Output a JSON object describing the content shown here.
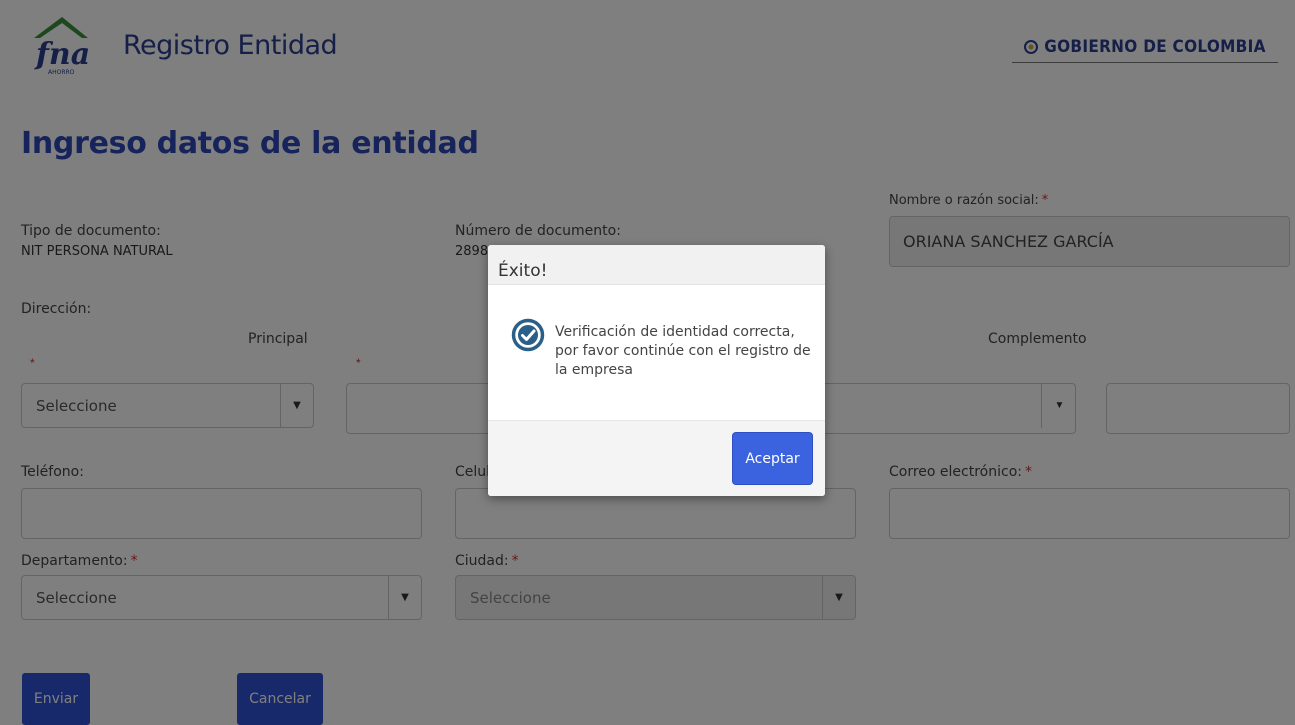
{
  "header": {
    "logo_text": "fna",
    "logo_sub": "AHORRO",
    "app_title": "Registro Entidad",
    "government": "GOBIERNO DE COLOMBIA"
  },
  "page_title": "Ingreso datos de la entidad",
  "form": {
    "doc_type_label": "Tipo de documento:",
    "doc_type_value": "NIT PERSONA NATURAL",
    "doc_number_label": "Número de documento:",
    "doc_number_value": "2898",
    "name_label": "Nombre o razón social:",
    "name_value": "ORIANA SANCHEZ GARCÍA",
    "address_label": "Dirección:",
    "principal_label": "Principal",
    "complemento_label": "Complemento",
    "required_mark": "*",
    "principal_select": "Seleccione",
    "phone_label": "Teléfono:",
    "cell_label": "Celul",
    "email_label": "Correo electrónico:",
    "department_label": "Departamento:",
    "department_select": "Seleccione",
    "city_label": "Ciudad:",
    "city_select": "Seleccione",
    "submit_button": "Enviar",
    "cancel_button": "Cancelar"
  },
  "modal": {
    "title": "Éxito!",
    "message": "Verificación de identidad correcta, por favor continúe con el registro de la empresa",
    "accept_button": "Aceptar"
  },
  "colors": {
    "brand_blue": "#2b3e8f",
    "button_blue": "#2f53d4",
    "required_red": "#d32f2f",
    "success_icon": "#2a5f8a"
  }
}
